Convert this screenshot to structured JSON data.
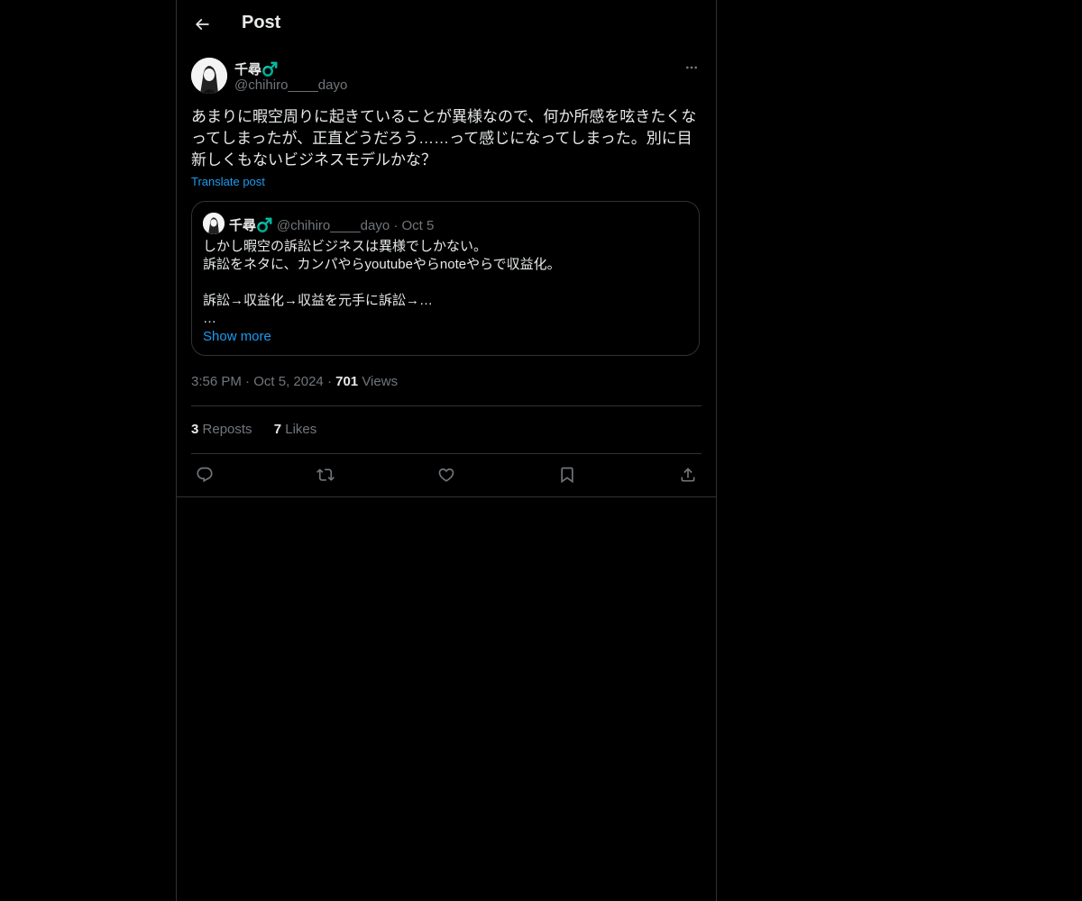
{
  "header": {
    "title": "Post"
  },
  "post": {
    "author_name": "千尋♂️",
    "author_handle": "@chihiro____dayo",
    "text": "あまりに暇空周りに起きていることが異様なので、何か所感を呟きたくなってしまったが、正直どうだろう……って感じになってしまった。別に目新しくもないビジネスモデルかな？",
    "translate_label": "Translate post",
    "time": "3:56 PM",
    "date": "Oct 5, 2024",
    "views_count": "701",
    "views_label": "Views",
    "reposts_count": "3",
    "reposts_label": "Reposts",
    "likes_count": "7",
    "likes_label": "Likes"
  },
  "quote": {
    "author_name": "千尋♂️",
    "author_handle": "@chihiro____dayo",
    "date": "Oct 5",
    "text": "しかし暇空の訴訟ビジネスは異様でしかない。\n訴訟をネタに、カンパやらyoutubeやらnoteやらで収益化。\n\n訴訟→収益化→収益を元手に訴訟→…\n…",
    "show_more": "Show more"
  },
  "icons": [
    "back-arrow-icon",
    "more-icon",
    "reply-icon",
    "repost-icon",
    "like-icon",
    "bookmark-icon",
    "share-icon"
  ],
  "colors": {
    "background": "#000000",
    "text": "#e7e9ea",
    "muted": "#71767b",
    "link": "#1d9bf0",
    "border": "#2f3336"
  }
}
